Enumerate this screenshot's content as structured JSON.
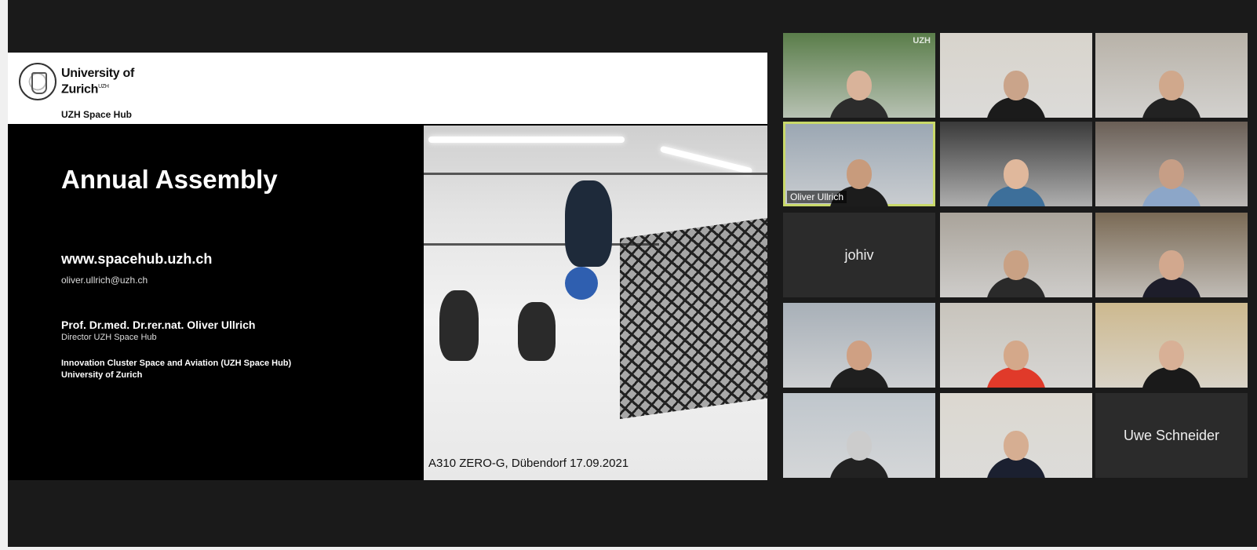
{
  "slide": {
    "university_name": "University of Zurich",
    "university_suffix": "UZH",
    "hub_label": "UZH Space Hub",
    "title": "Annual Assembly",
    "website": "www.spacehub.uzh.ch",
    "email": "oliver.ullrich@uzh.ch",
    "presenter_name": "Prof. Dr.med. Dr.rer.nat. Oliver Ullrich",
    "presenter_role": "Director UZH Space Hub",
    "cluster": "Innovation Cluster Space and Aviation (UZH Space Hub)",
    "institution": "University of Zurich",
    "photo_caption": "A310 ZERO-G, Dübendorf 17.09.2021"
  },
  "participants": [
    {
      "name": "",
      "label": "",
      "mark": "UZH",
      "video": true
    },
    {
      "name": "",
      "label": "",
      "mark": "",
      "video": true
    },
    {
      "name": "",
      "label": "",
      "mark": "",
      "video": true
    },
    {
      "name": "Oliver Ullrich",
      "label": "Oliver Ullrich",
      "mark": "",
      "video": true,
      "active": true
    },
    {
      "name": "",
      "label": "",
      "mark": "",
      "video": true
    },
    {
      "name": "",
      "label": "",
      "mark": "",
      "video": true
    },
    {
      "name": "johiv",
      "label": "",
      "mark": "",
      "video": false
    },
    {
      "name": "",
      "label": "",
      "mark": "",
      "video": true
    },
    {
      "name": "",
      "label": "",
      "mark": "",
      "video": true
    },
    {
      "name": "",
      "label": "",
      "mark": "",
      "video": true
    },
    {
      "name": "",
      "label": "",
      "mark": "",
      "video": true
    },
    {
      "name": "",
      "label": "",
      "mark": "",
      "video": true
    },
    {
      "name": "",
      "label": "",
      "mark": "",
      "video": true
    },
    {
      "name": "",
      "label": "",
      "mark": "",
      "video": true
    },
    {
      "name": "Uwe Schneider",
      "label": "",
      "mark": "",
      "video": false
    }
  ],
  "colors": {
    "active_speaker_border": "#c9d96a",
    "tile_bg": "#2b2b2b",
    "stage_bg": "#1a1a1a"
  }
}
